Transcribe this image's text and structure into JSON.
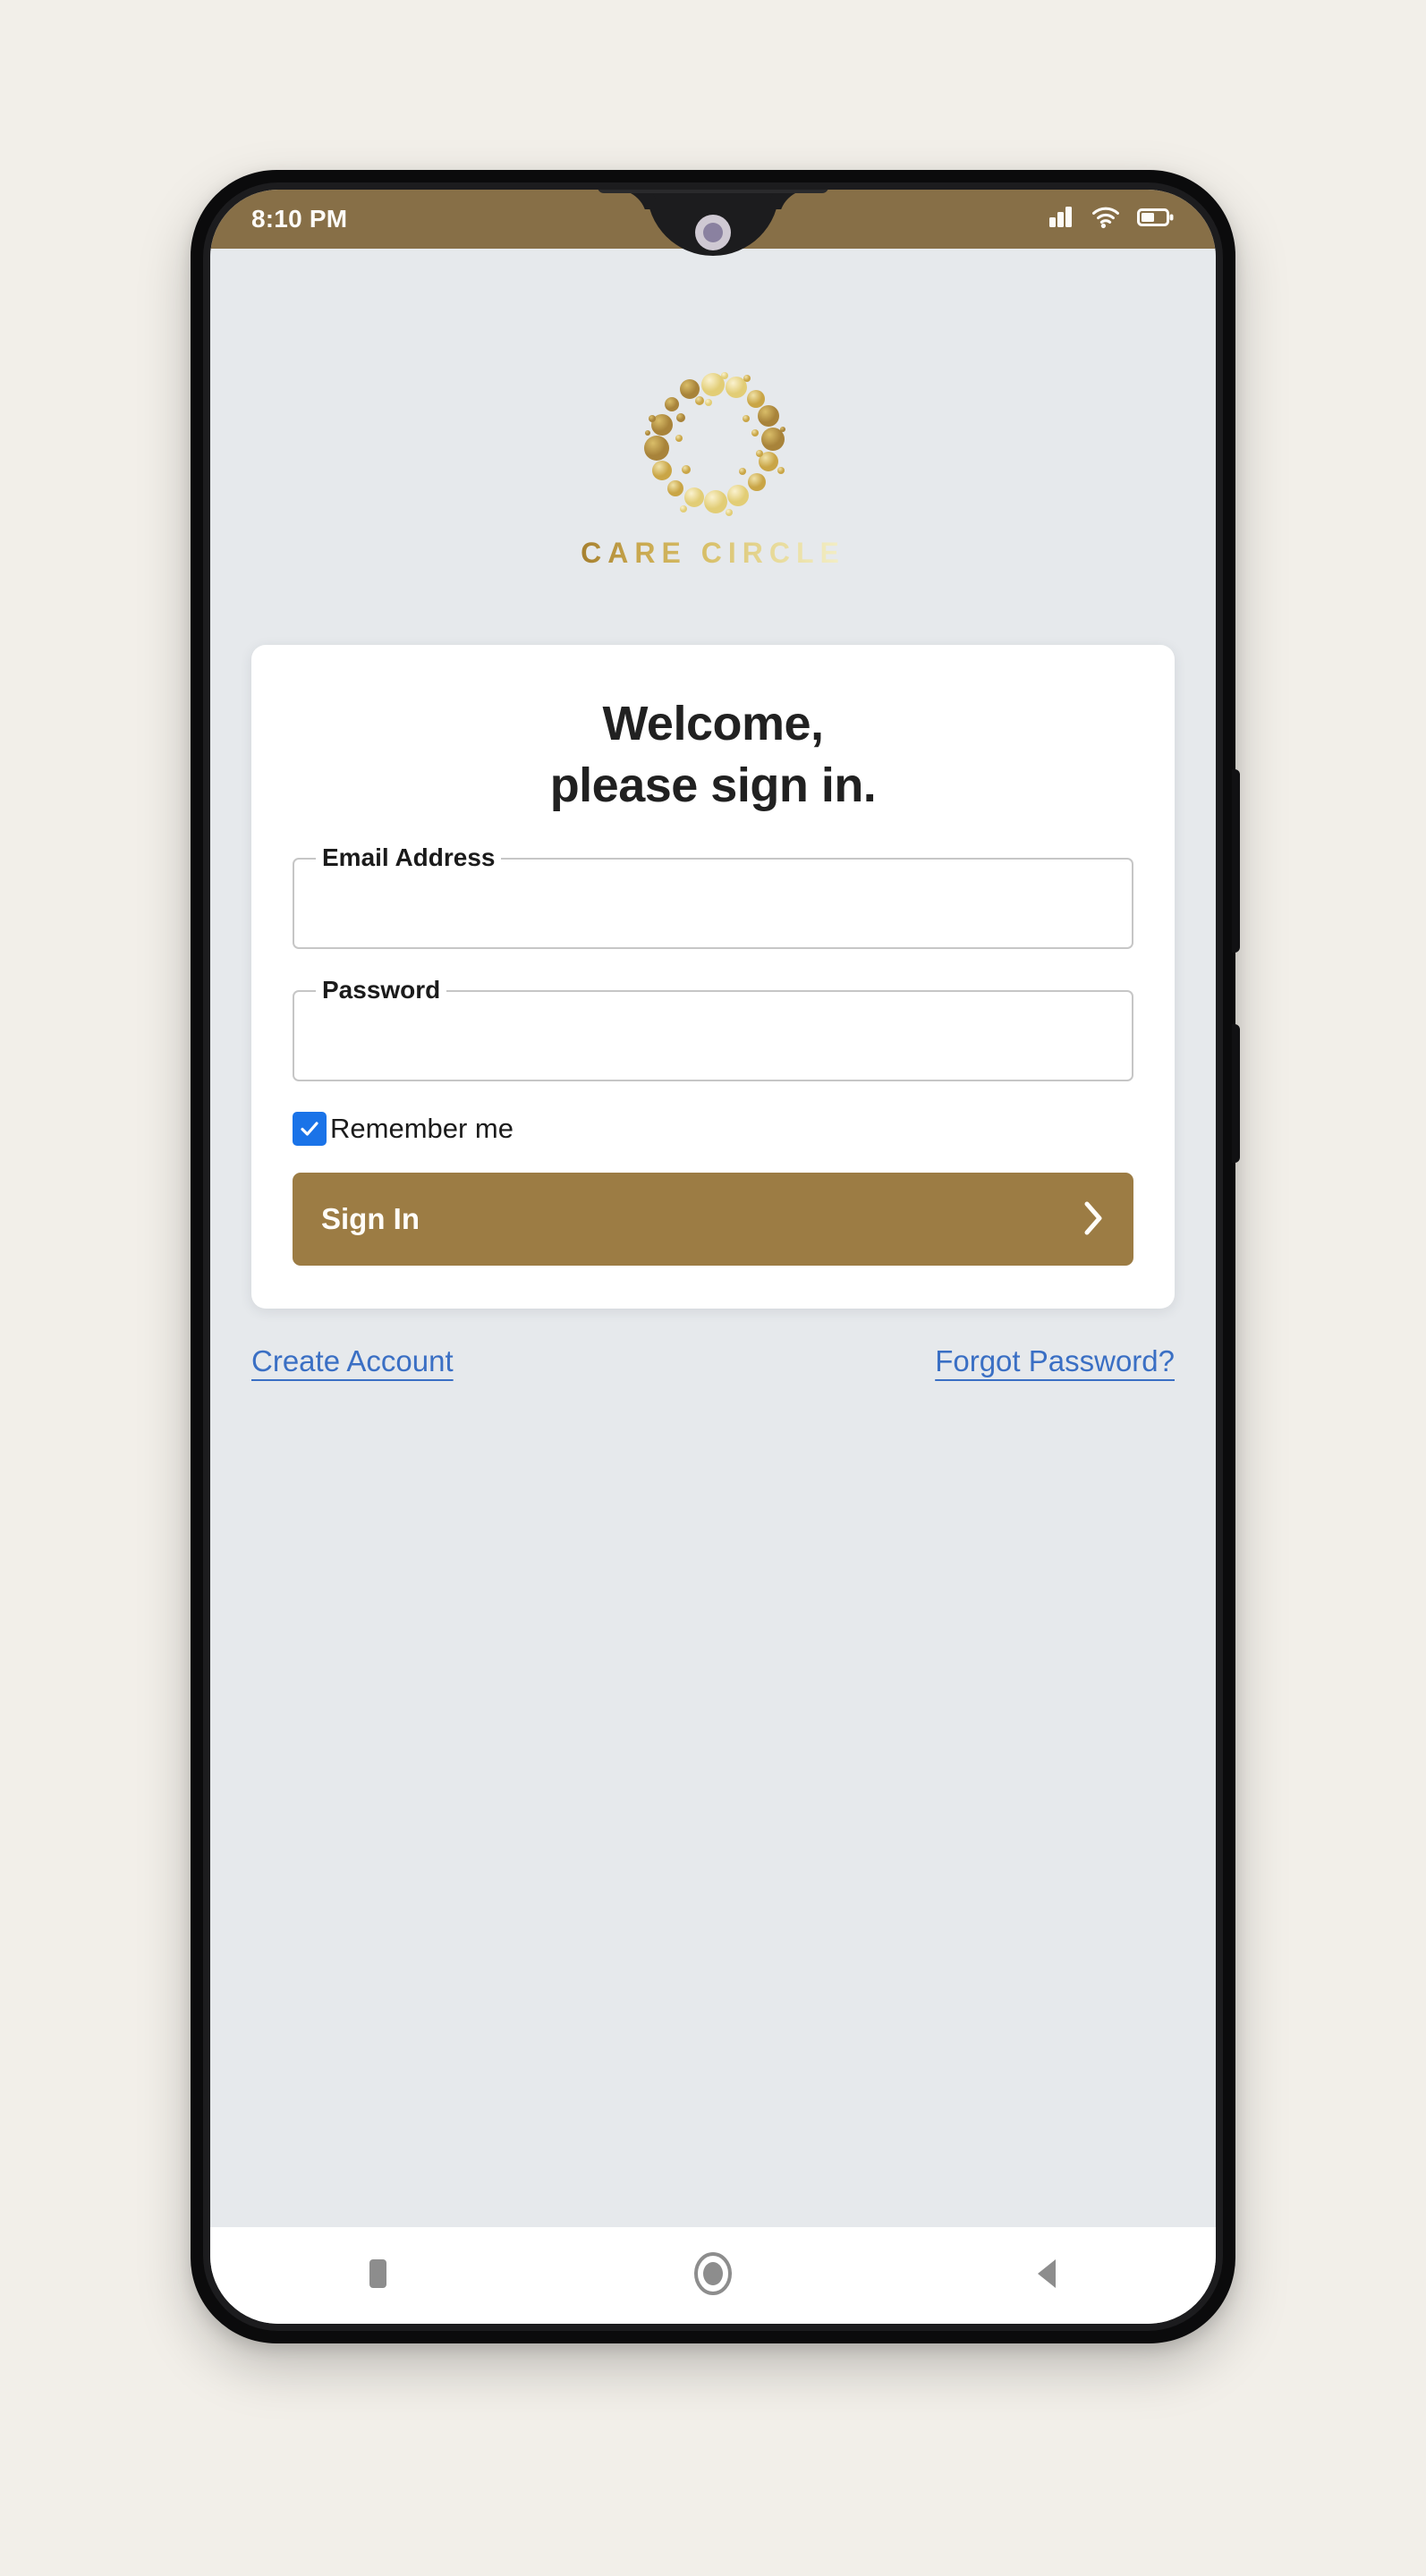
{
  "device": {
    "type": "android-phone",
    "frame_color": "#0b0b0c",
    "page_background": "#f2efe9"
  },
  "status_bar": {
    "time": "8:10 PM",
    "background_color": "#876f47",
    "text_color": "#fdfbf7",
    "icons": [
      {
        "name": "cellular-signal-icon",
        "bars": 3,
        "filled": 3
      },
      {
        "name": "wifi-icon",
        "strength": "full"
      },
      {
        "name": "battery-icon",
        "level_percent": 50
      }
    ]
  },
  "app": {
    "background_color": "#e6e9ec",
    "brand": {
      "wordmark": "CARE CIRCLE",
      "logo_icon": "dotted-ring-logo",
      "gradient_start": "#a6802f",
      "gradient_end": "#f3efc9"
    },
    "card": {
      "heading_line1": "Welcome,",
      "heading_line2": "please sign in.",
      "fields": [
        {
          "name": "email",
          "label": "Email Address",
          "value": "",
          "placeholder": "",
          "type": "email"
        },
        {
          "name": "password",
          "label": "Password",
          "value": "",
          "placeholder": "",
          "type": "password"
        }
      ],
      "remember_me": {
        "label": "Remember me",
        "checked": true,
        "accent_color": "#1a73e8"
      },
      "submit": {
        "label": "Sign In",
        "icon": "chevron-right-icon",
        "background_color": "#9c7c44",
        "text_color": "#fffdf8"
      }
    },
    "links": [
      {
        "name": "create-account",
        "label": "Create Account",
        "color": "#3a6fc4"
      },
      {
        "name": "forgot-password",
        "label": "Forgot Password?",
        "color": "#3a6fc4"
      }
    ]
  },
  "nav_bar": {
    "background_color": "#ffffff",
    "buttons": [
      {
        "name": "recents-button",
        "icon": "square-icon"
      },
      {
        "name": "home-button",
        "icon": "circle-icon"
      },
      {
        "name": "back-button",
        "icon": "triangle-left-icon"
      }
    ]
  }
}
